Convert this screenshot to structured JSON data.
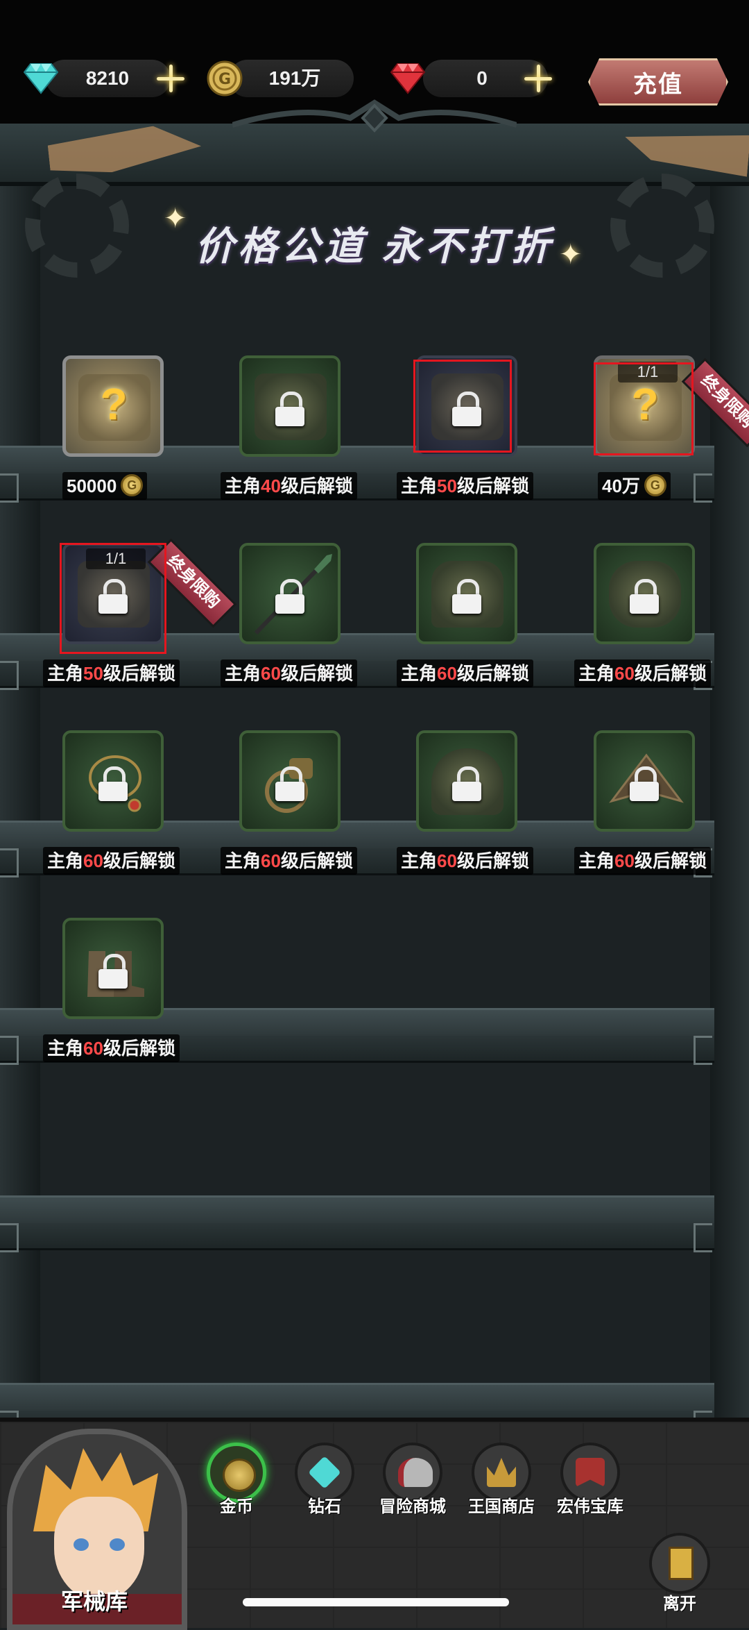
{
  "currency": {
    "diamond": "8210",
    "gold": "191万",
    "ruby": "0",
    "recharge_label": "充值"
  },
  "banner": {
    "slogan": "价格公道 永不打折"
  },
  "items": [
    {
      "label": "50000",
      "state": "available",
      "icon": "mystery-chest"
    },
    {
      "label_prefix": "主角",
      "label_level": "40",
      "label_suffix": "级后解锁",
      "state": "locked",
      "icon": "chest"
    },
    {
      "label_prefix": "主角",
      "label_level": "50",
      "label_suffix": "级后解锁",
      "state": "locked",
      "icon": "chest",
      "highlighted": true
    },
    {
      "label": "40万",
      "state": "available",
      "icon": "mystery-chest",
      "limit": "1/1",
      "ribbon": "终身限购",
      "highlighted": true
    },
    {
      "label_prefix": "主角",
      "label_level": "50",
      "label_suffix": "级后解锁",
      "state": "locked",
      "icon": "chest",
      "limit": "1/1",
      "ribbon": "终身限购",
      "highlighted": true
    },
    {
      "label_prefix": "主角",
      "label_level": "60",
      "label_suffix": "级后解锁",
      "state": "locked",
      "icon": "spear"
    },
    {
      "label_prefix": "主角",
      "label_level": "60",
      "label_suffix": "级后解锁",
      "state": "locked",
      "icon": "armor"
    },
    {
      "label_prefix": "主角",
      "label_level": "60",
      "label_suffix": "级后解锁",
      "state": "locked",
      "icon": "gauntlet"
    },
    {
      "label_prefix": "主角",
      "label_level": "60",
      "label_suffix": "级后解锁",
      "state": "locked",
      "icon": "amulet"
    },
    {
      "label_prefix": "主角",
      "label_level": "60",
      "label_suffix": "级后解锁",
      "state": "locked",
      "icon": "ring"
    },
    {
      "label_prefix": "主角",
      "label_level": "60",
      "label_suffix": "级后解锁",
      "state": "locked",
      "icon": "helmet"
    },
    {
      "label_prefix": "主角",
      "label_level": "60",
      "label_suffix": "级后解锁",
      "state": "locked",
      "icon": "hat"
    },
    {
      "label_prefix": "主角",
      "label_level": "60",
      "label_suffix": "级后解锁",
      "state": "locked",
      "icon": "boots"
    }
  ],
  "nav": {
    "tabs": [
      {
        "label": "金币",
        "icon": "gold-coin-icon",
        "active": true
      },
      {
        "label": "钻石",
        "icon": "diamond-icon"
      },
      {
        "label": "冒险商城",
        "icon": "knight-helmet-icon"
      },
      {
        "label": "王国商店",
        "icon": "crown-icon"
      },
      {
        "label": "宏伟宝库",
        "icon": "treasure-banner-icon"
      }
    ],
    "current_shop": "军械库",
    "leave_label": "离开"
  },
  "colors": {
    "level_text": "#ff4a4a",
    "active_tab": "#3cc04a",
    "highlight_box": "#e5161f",
    "recharge_button": "#8e3f3d"
  }
}
